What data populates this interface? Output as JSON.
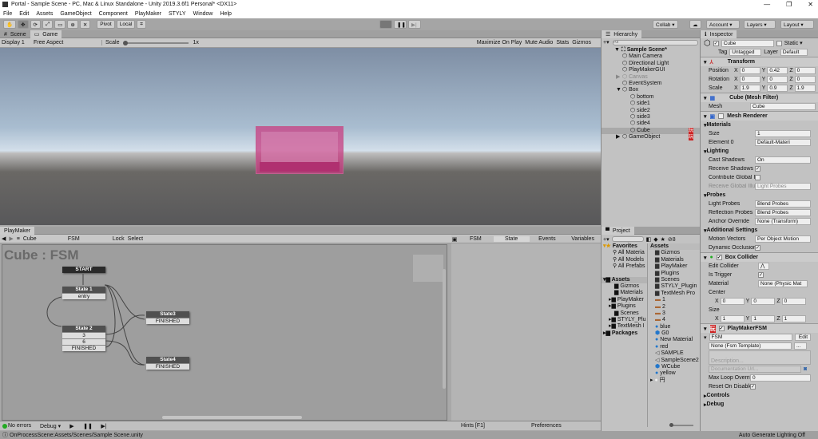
{
  "window": {
    "title": "Portal - Sample Scene - PC, Mac & Linux Standalone - Unity 2019.3.6f1 Personal* <DX11>",
    "minimize": "—",
    "maximize": "❐",
    "close": "✕"
  },
  "menu": [
    "File",
    "Edit",
    "Assets",
    "GameObject",
    "Component",
    "PlayMaker",
    "STYLY",
    "Window",
    "Help"
  ],
  "toolbar": {
    "pivot": "Pivot",
    "local": "Local",
    "collab": "Collab ▾",
    "account": "Account ▾",
    "layers": "Layers ▾",
    "layout": "Layout ▾"
  },
  "game": {
    "tabs": [
      "Scene",
      "Game"
    ],
    "display": "Display 1",
    "aspect": "Free Aspect",
    "scale_label": "Scale",
    "scale_value": "1x",
    "scale_fraction": 0.0,
    "buttons": [
      "Maximize On Play",
      "Mute Audio",
      "Stats",
      "Gizmos"
    ]
  },
  "hierarchy": {
    "title": "Hierarchy",
    "search_placeholder": "All",
    "scene": "Sample Scene*",
    "items": [
      {
        "label": "Main Camera",
        "depth": 1
      },
      {
        "label": "Directional Light",
        "depth": 1
      },
      {
        "label": "PlayMakerGUI",
        "depth": 1
      },
      {
        "label": "Canvas",
        "depth": 1,
        "disabled": true,
        "arrow": "▶"
      },
      {
        "label": "EventSystem",
        "depth": 1
      },
      {
        "label": "Box",
        "depth": 1,
        "arrow": "▼"
      },
      {
        "label": "bottom",
        "depth": 2
      },
      {
        "label": "side1",
        "depth": 2
      },
      {
        "label": "side2",
        "depth": 2
      },
      {
        "label": "side3",
        "depth": 2
      },
      {
        "label": "side4",
        "depth": 2
      },
      {
        "label": "Cube",
        "depth": 2,
        "selected": true,
        "badge": "玩"
      },
      {
        "label": "GameObject",
        "depth": 1,
        "arrow": "▶",
        "badge": "玩"
      }
    ]
  },
  "inspector": {
    "title": "Inspector",
    "object_name": "Cube",
    "static_label": "Static ▾",
    "tag_label": "Tag",
    "tag": "Untagged",
    "layer_label": "Layer",
    "layer": "Default",
    "transform": {
      "title": "Transform",
      "rows": [
        {
          "label": "Position",
          "x": "0",
          "y": "0.42",
          "z": "0"
        },
        {
          "label": "Rotation",
          "x": "0",
          "y": "0",
          "z": "0"
        },
        {
          "label": "Scale",
          "x": "1.9",
          "y": "0.9",
          "z": "1.9"
        }
      ]
    },
    "mesh_filter": {
      "title": "Cube (Mesh Filter)",
      "mesh_label": "Mesh",
      "mesh": "Cube"
    },
    "mesh_renderer": {
      "title": "Mesh Renderer",
      "materials": "Materials",
      "size_label": "Size",
      "size": "1",
      "element_label": "Element 0",
      "element": "Default-Materi",
      "lighting": "Lighting",
      "cast_label": "Cast Shadows",
      "cast": "On",
      "receive_label": "Receive Shadows",
      "contrib_label": "Contribute Global I",
      "recv_gi_label": "Receive Global Illu",
      "recv_gi": "Light Probes",
      "probes": "Probes",
      "light_probes_label": "Light Probes",
      "light_probes": "Blend Probes",
      "refl_label": "Reflection Probes",
      "refl": "Blend Probes",
      "anchor_label": "Anchor Override",
      "anchor": "None (Transform)",
      "additional": "Additional Settings",
      "motion_label": "Motion Vectors",
      "motion": "Per Object Motion",
      "occl_label": "Dynamic Occlusion"
    },
    "box_collider": {
      "title": "Box Collider",
      "edit_label": "Edit Collider",
      "trigger_label": "Is Trigger",
      "material_label": "Material",
      "material": "None (Physic Mat",
      "center_label": "Center",
      "center": {
        "x": "0",
        "y": "0",
        "z": "0"
      },
      "size_label": "Size",
      "size": {
        "x": "1",
        "y": "1",
        "z": "1"
      }
    },
    "playmaker_fsm": {
      "title": "PlayMakerFSM",
      "fsm_name": "FSM",
      "edit": "Edit",
      "template": "None (Fsm Template)",
      "template_btn": "...",
      "description_placeholder": "Description...",
      "doc_placeholder": "Documentation Url...",
      "maxloop_label": "Max Loop Overrid",
      "maxloop": "0",
      "reset_label": "Reset On Disable"
    },
    "controls": "Controls",
    "debug": "Debug"
  },
  "playmaker": {
    "title": "PlayMaker",
    "object": "Cube",
    "fsm": "FSM",
    "lock": "Lock",
    "select": "Select",
    "graph_title": "Cube : FSM",
    "start": "START",
    "states": [
      {
        "name": "State 1",
        "transitions": [
          "entry"
        ]
      },
      {
        "name": "State 2",
        "transitions": [
          "3",
          "6",
          "FINISHED"
        ]
      },
      {
        "name": "State3",
        "transitions": [
          "FINISHED"
        ]
      },
      {
        "name": "State4",
        "transitions": [
          "FINISHED"
        ]
      }
    ],
    "tabs": [
      "FSM",
      "State",
      "Events",
      "Variables"
    ],
    "active_tab": "State",
    "errors": "No errors",
    "debug": "Debug ▾",
    "hints": "Hints [F1]",
    "preferences": "Preferences"
  },
  "project": {
    "title": "Project",
    "favorites": "Favorites",
    "fav_items": [
      "All Materia",
      "All Models",
      "All Prefabs"
    ],
    "assets": "Assets",
    "tree": [
      "Gizmos",
      "Materials",
      "PlayMaker",
      "Plugins",
      "Scenes",
      "STYLY_Plu",
      "TextMesh I"
    ],
    "packages": "Packages",
    "badge": "8",
    "list_title": "Assets",
    "list": [
      {
        "n": "Gizmos",
        "i": "folder"
      },
      {
        "n": "Materials",
        "i": "folder"
      },
      {
        "n": "PlayMaker",
        "i": "folder"
      },
      {
        "n": "Plugins",
        "i": "folder"
      },
      {
        "n": "Scenes",
        "i": "folder"
      },
      {
        "n": "STYLY_Plugin",
        "i": "folder"
      },
      {
        "n": "TextMesh Pro",
        "i": "folder"
      },
      {
        "n": "1",
        "i": "tex"
      },
      {
        "n": "2",
        "i": "tex"
      },
      {
        "n": "3",
        "i": "tex"
      },
      {
        "n": "4",
        "i": "tex"
      },
      {
        "n": "blue",
        "i": "mat"
      },
      {
        "n": "G0",
        "i": "prefab"
      },
      {
        "n": "New Material",
        "i": "mat"
      },
      {
        "n": "red",
        "i": "mat"
      },
      {
        "n": "SAMPLE",
        "i": "scene"
      },
      {
        "n": "SampleScene2",
        "i": "scene"
      },
      {
        "n": "WCube",
        "i": "prefab"
      },
      {
        "n": "yellow",
        "i": "mat"
      },
      {
        "n": "円",
        "i": "sphere"
      }
    ]
  },
  "status": {
    "message": "OnProcessScene:Assets/Scenes/Sample Scene.unity",
    "lighting": "Auto Generate Lighting Off"
  }
}
